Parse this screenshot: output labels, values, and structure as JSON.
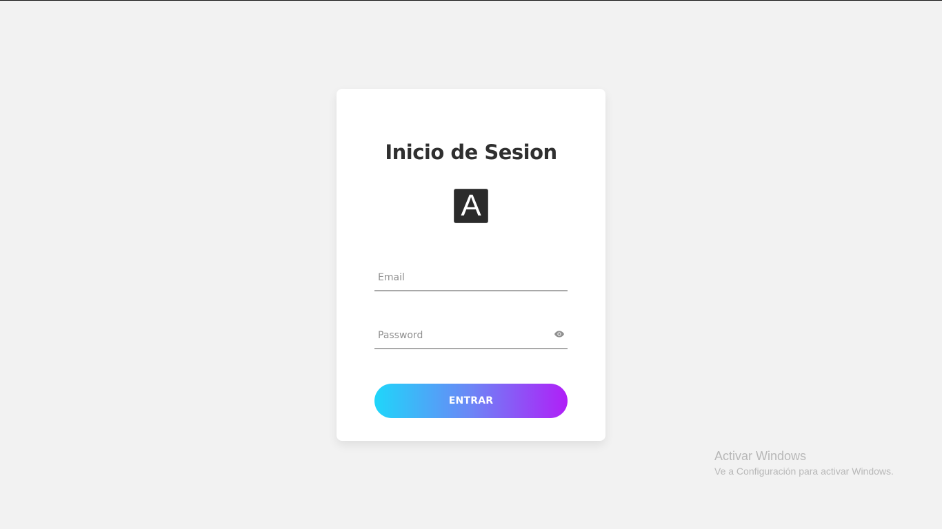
{
  "login": {
    "title": "Inicio de Sesion",
    "logo_letter": "A",
    "email_placeholder": "Email",
    "email_value": "",
    "password_placeholder": "Password",
    "password_value": "",
    "show_password_icon": "eye-icon",
    "submit_label": "ENTRAR"
  },
  "watermark": {
    "title": "Activar Windows",
    "subtitle": "Ve a Configuración para activar Windows."
  },
  "colors": {
    "background": "#f2f2f2",
    "card": "#ffffff",
    "button_gradient_start": "#1fd6fa",
    "button_gradient_end": "#b01ff7",
    "title_text": "#2f2f2f"
  }
}
